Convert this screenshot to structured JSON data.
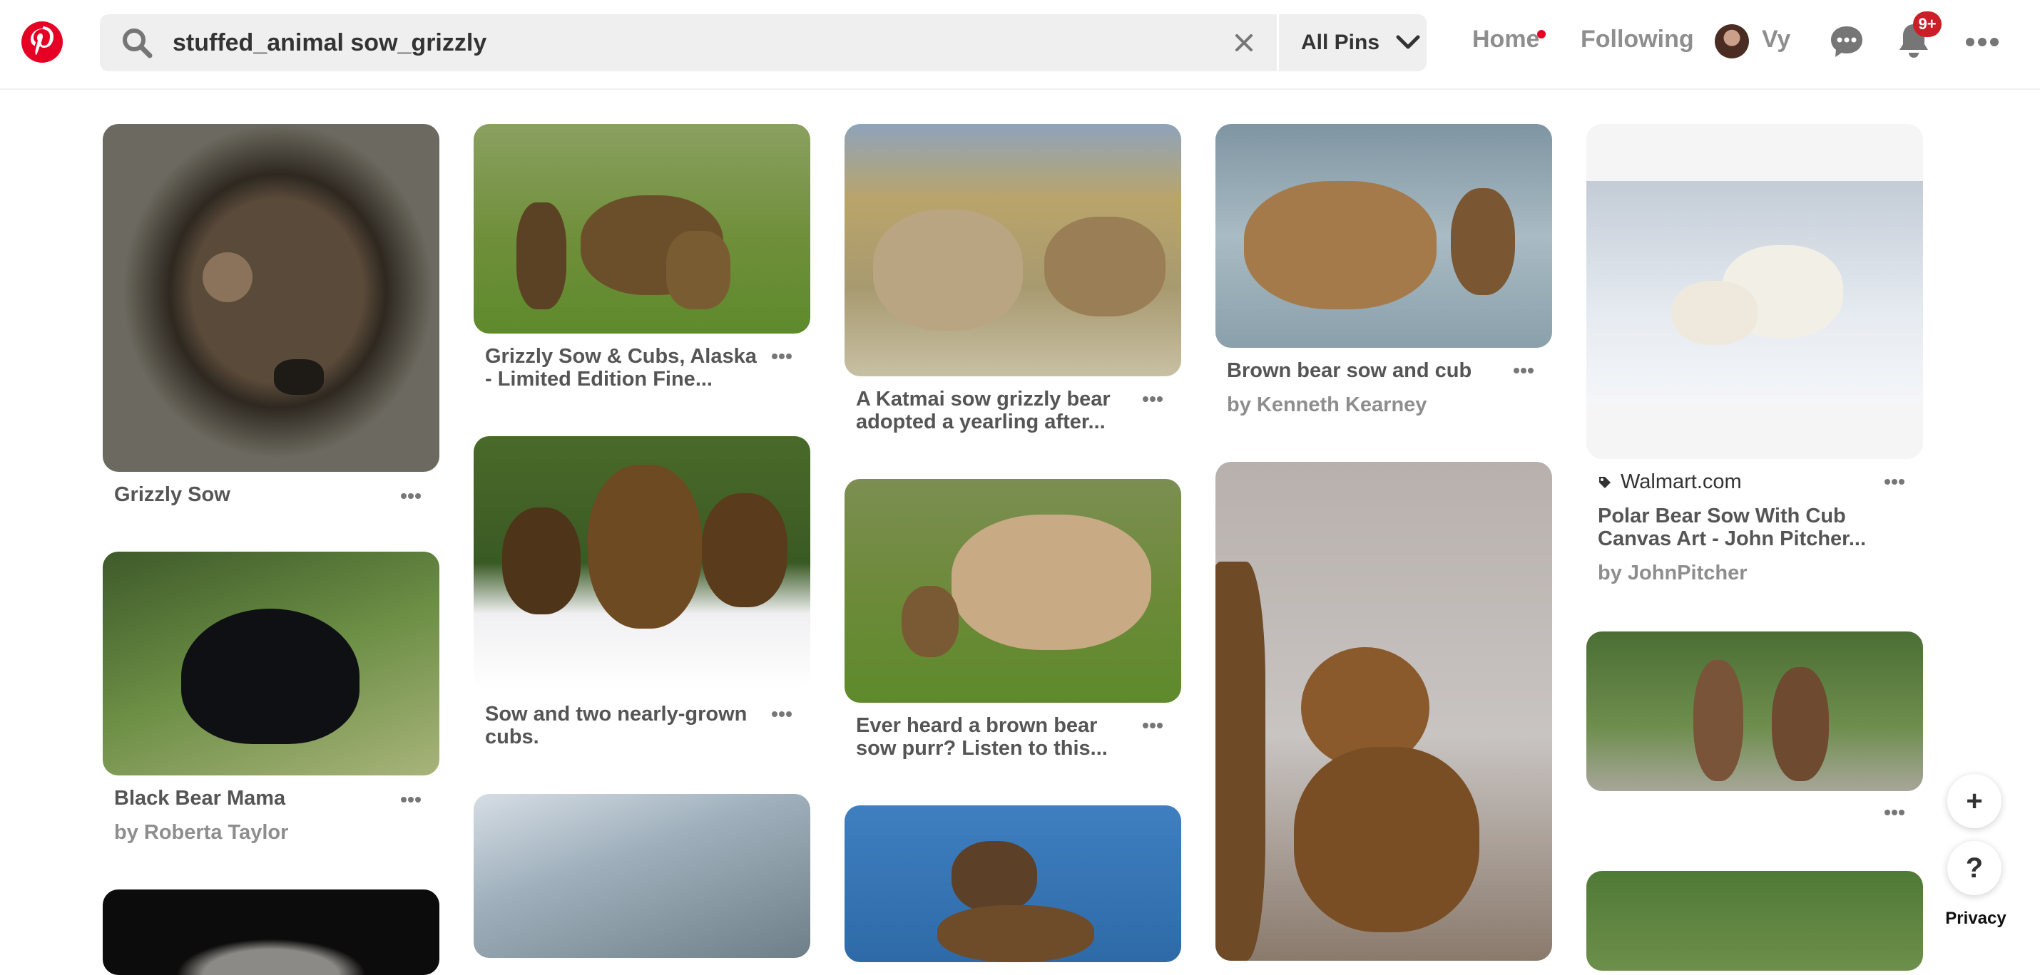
{
  "header": {
    "logo_icon": "pinterest-logo",
    "search": {
      "query": "stuffed_animal sow_grizzly",
      "icon": "search-icon"
    },
    "filter_label": "All Pins",
    "nav": {
      "home": "Home",
      "following": "Following",
      "profile_name": "Vy"
    },
    "notification_count": "9+",
    "accent_color": "#e60023"
  },
  "pins": [
    {
      "title": "Grizzly Sow"
    },
    {
      "title": "Black Bear Mama",
      "subtitle": "by Roberta Taylor"
    },
    {
      "title": ""
    },
    {
      "title": "Grizzly Sow & Cubs, Alaska - Limited Edition Fine..."
    },
    {
      "title": "Sow and two nearly-grown cubs."
    },
    {
      "title": ""
    },
    {
      "title": "A Katmai sow grizzly bear adopted a yearling after..."
    },
    {
      "title": "Ever heard a brown bear sow purr? Listen to this..."
    },
    {
      "title": ""
    },
    {
      "title": "Brown bear sow and cub",
      "subtitle": "by Kenneth Kearney"
    },
    {
      "title": ""
    },
    {
      "source": "Walmart.com",
      "title": "Polar Bear Sow With Cub Canvas Art - John Pitcher...",
      "subtitle": "by JohnPitcher"
    },
    {
      "title": ""
    },
    {
      "title": ""
    }
  ],
  "floating": {
    "add": "+",
    "help": "?",
    "privacy": "Privacy"
  }
}
